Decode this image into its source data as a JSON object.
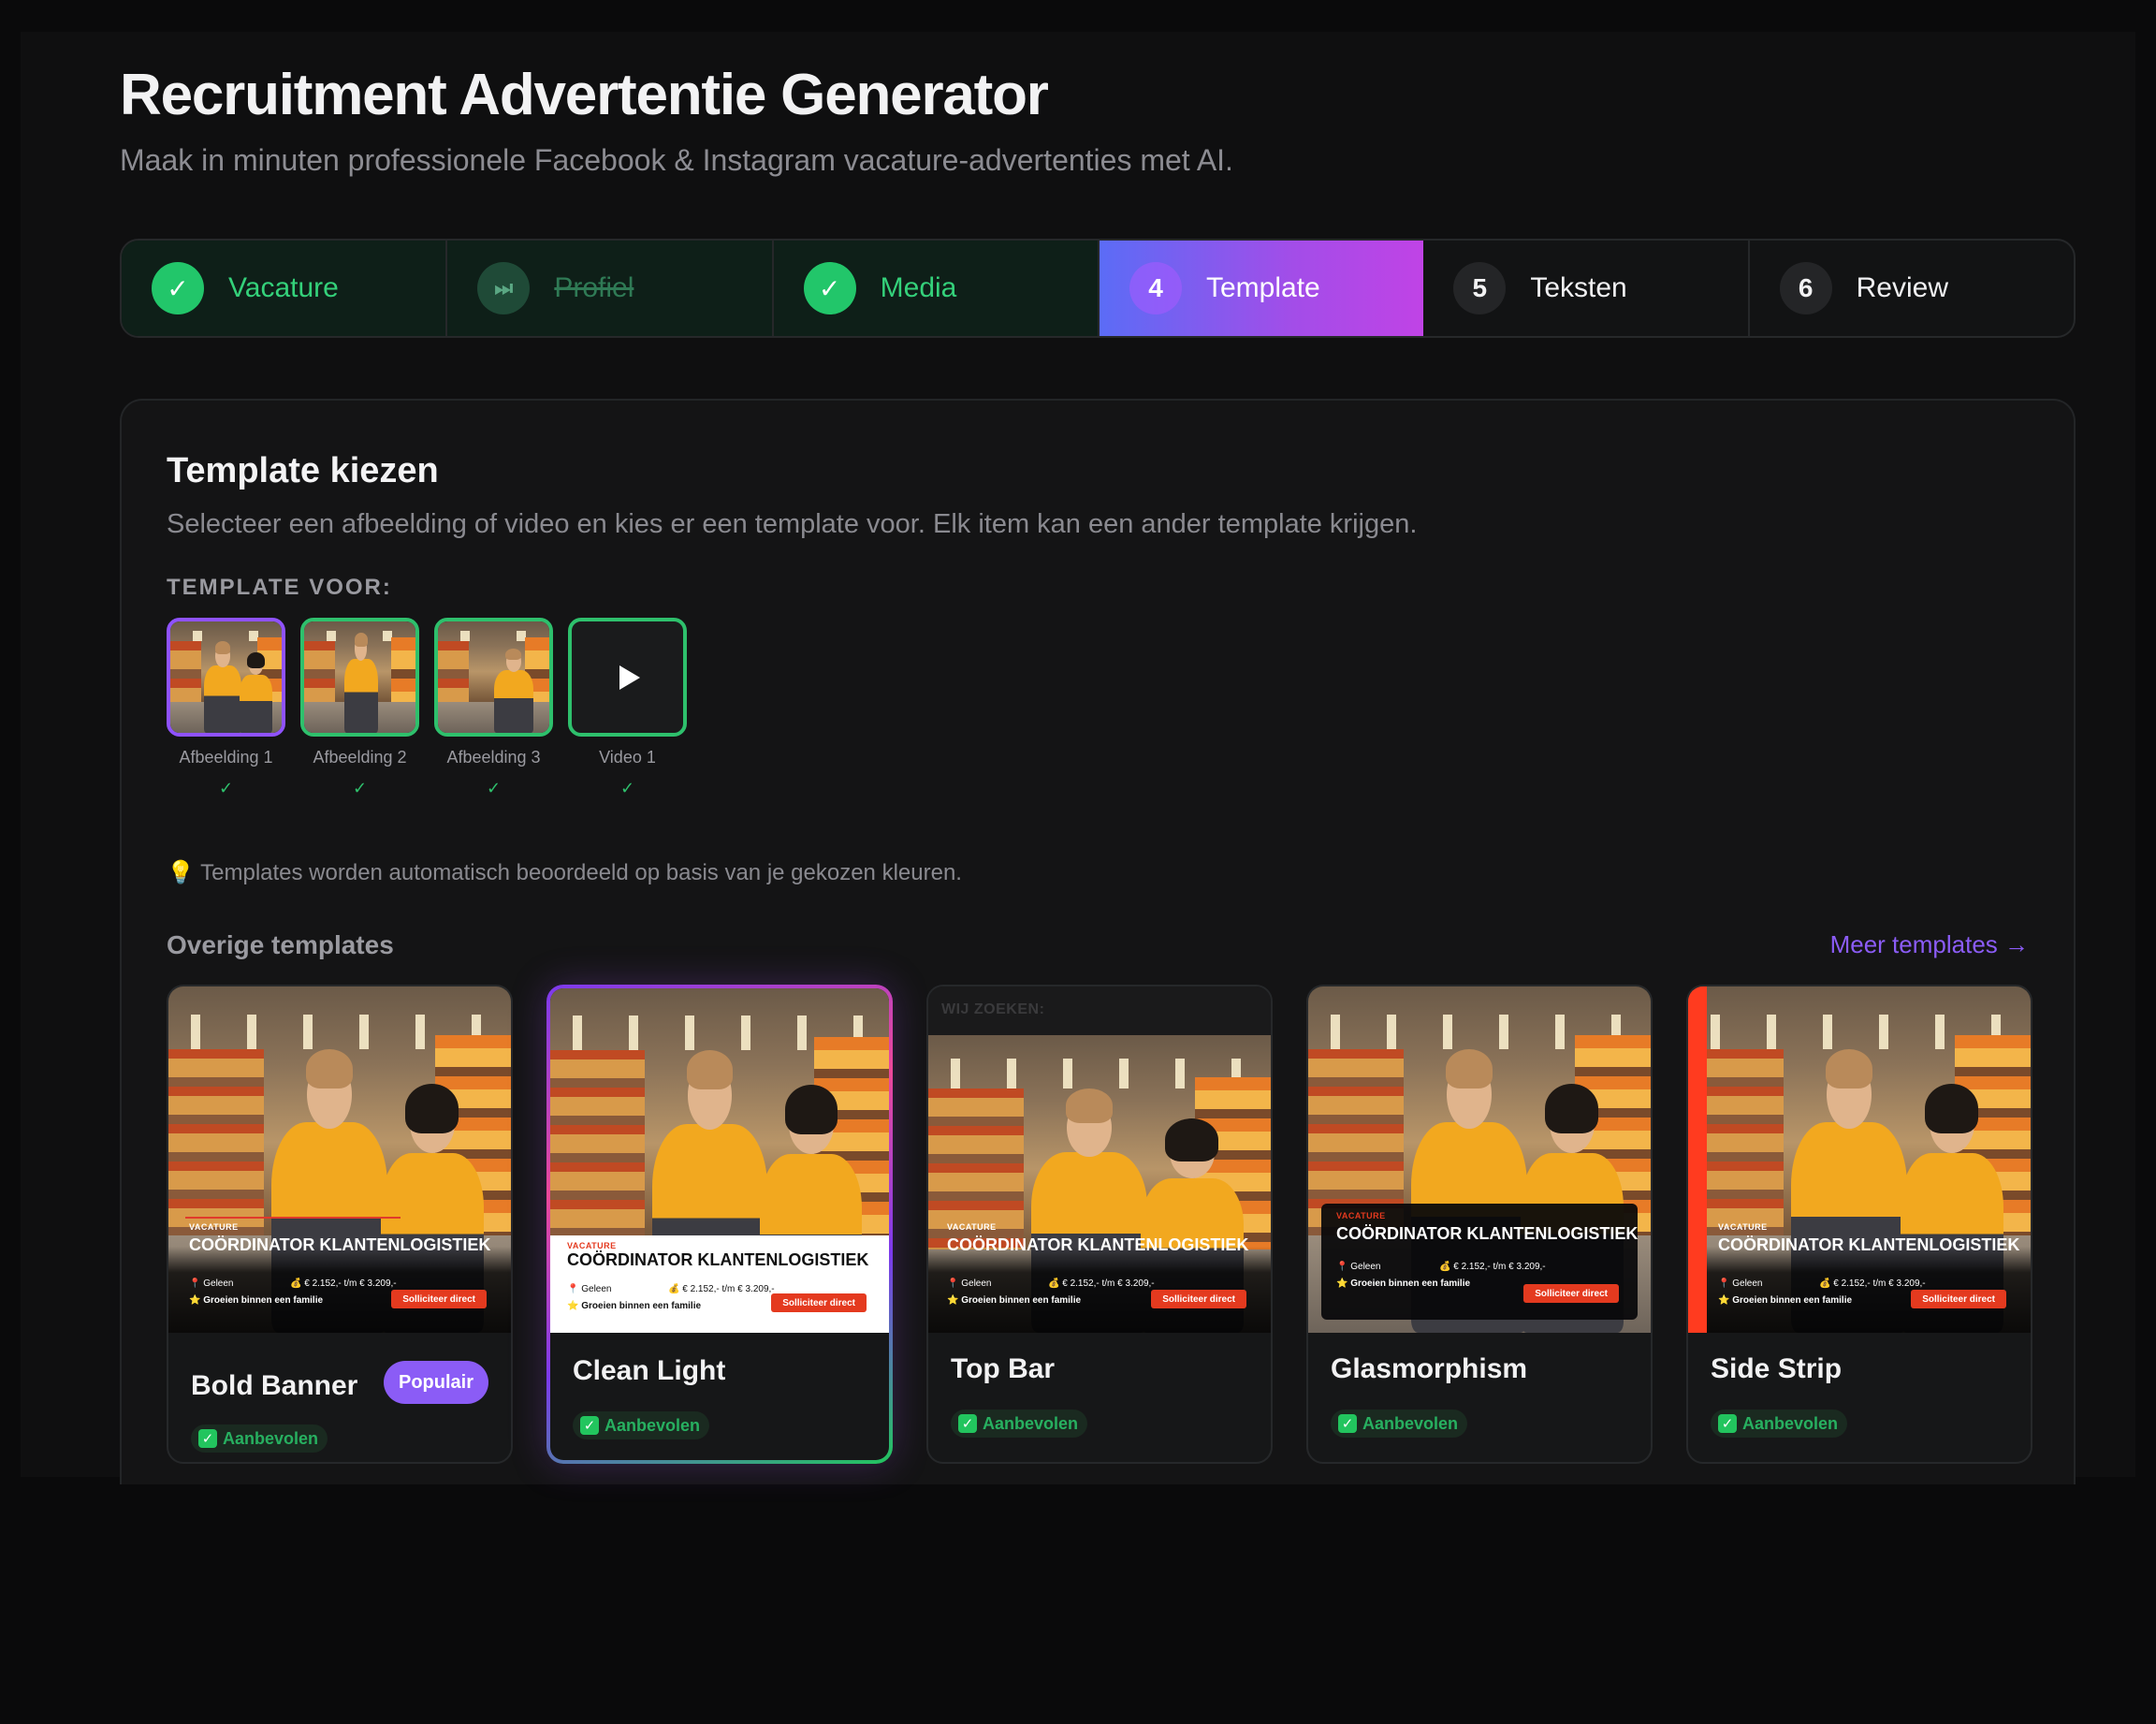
{
  "header": {
    "title": "Recruitment Advertentie Generator",
    "subtitle": "Maak in minuten professionele Facebook & Instagram vacature-advertenties met AI."
  },
  "stepper": {
    "steps": [
      {
        "marker": "✓",
        "label": "Vacature",
        "state": "done"
      },
      {
        "marker": "⏭",
        "label": "Profiel",
        "state": "skipped"
      },
      {
        "marker": "✓",
        "label": "Media",
        "state": "done"
      },
      {
        "marker": "4",
        "label": "Template",
        "state": "active"
      },
      {
        "marker": "5",
        "label": "Teksten",
        "state": "pending"
      },
      {
        "marker": "6",
        "label": "Review",
        "state": "pending"
      }
    ]
  },
  "template_section": {
    "title": "Template kiezen",
    "description": "Selecteer een afbeelding of video en kies er een template voor. Elk item kan een ander template krijgen.",
    "for_label": "TEMPLATE VOOR:",
    "media": [
      {
        "caption": "Afbeelding 1",
        "check": "✓",
        "selected": true
      },
      {
        "caption": "Afbeelding 2",
        "check": "✓",
        "selected": false
      },
      {
        "caption": "Afbeelding 3",
        "check": "✓",
        "selected": false
      },
      {
        "caption": "Video 1",
        "check": "✓",
        "selected": false
      }
    ],
    "hint": "Templates worden automatisch beoordeeld op basis van je gekozen kleuren.",
    "others_label": "Overige templates",
    "more_link": "Meer templates →"
  },
  "ad_preview": {
    "kicker": "VACATURE",
    "kicker_light": "VACATURE",
    "job_title": "COÖRDINATOR KLANTENLOGISTIEK",
    "location": "📍 Geleen",
    "salary": "💰 € 2.152,- t/m € 3.209,-",
    "perk": "⭐ Groeien binnen een familie",
    "cta": "Solliciteer direct",
    "topbar_text": "WIJ ZOEKEN:"
  },
  "templates": [
    {
      "name": "Bold Banner",
      "badge": "Populair",
      "recommended": "Aanbevolen"
    },
    {
      "name": "Clean Light",
      "recommended": "Aanbevolen",
      "selected": true
    },
    {
      "name": "Top Bar",
      "recommended": "Aanbevolen"
    },
    {
      "name": "Glasmorphism",
      "recommended": "Aanbevolen"
    },
    {
      "name": "Side Strip",
      "recommended": "Aanbevolen"
    }
  ],
  "colors": {
    "accent_purple": "#8b5cf6",
    "success_green": "#22c55e",
    "cta_red": "#e43a1f",
    "active_gradient_start": "#5b6cf6",
    "active_gradient_end": "#c043e6"
  }
}
